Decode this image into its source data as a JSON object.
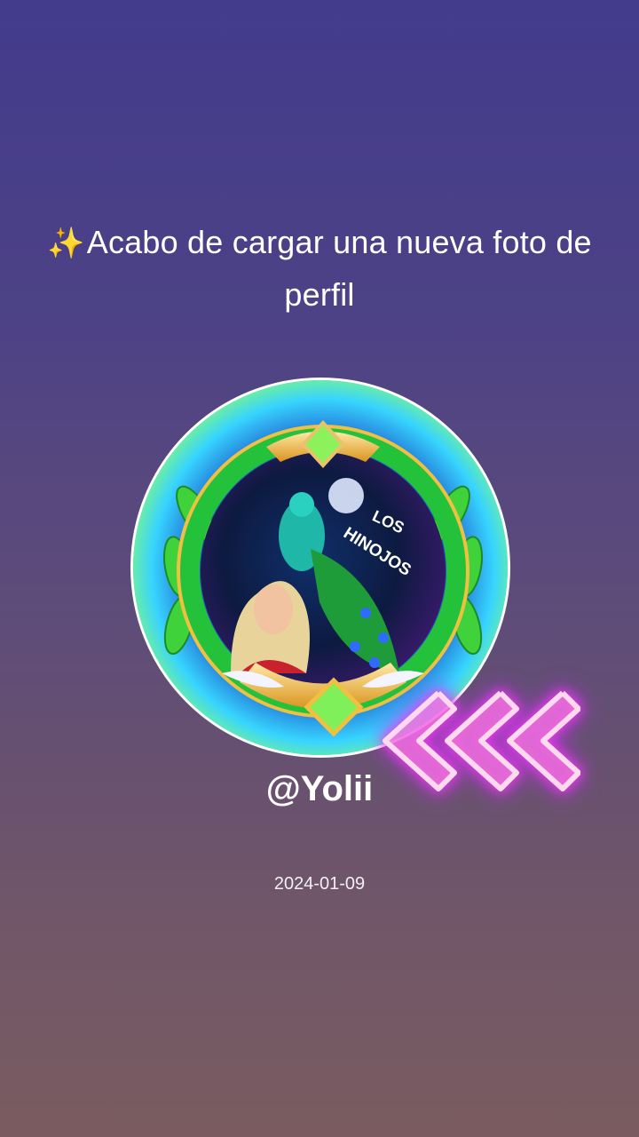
{
  "post": {
    "sparkle_icon": "✨",
    "headline": "Acabo de cargar una nueva foto de perfil",
    "username": "@Yolii",
    "date": "2024-01-09",
    "badge_text_line1": "LOS",
    "badge_text_line2": "HINOJOS"
  },
  "colors": {
    "background_top": "#433b8c",
    "background_bottom": "#7a5c60",
    "chevron_glow": "#ff3df2",
    "frame_green": "#23c23a"
  },
  "icons": {
    "sparkle": "sparkles-icon",
    "chevrons": "triple-chevron-left-icon"
  }
}
